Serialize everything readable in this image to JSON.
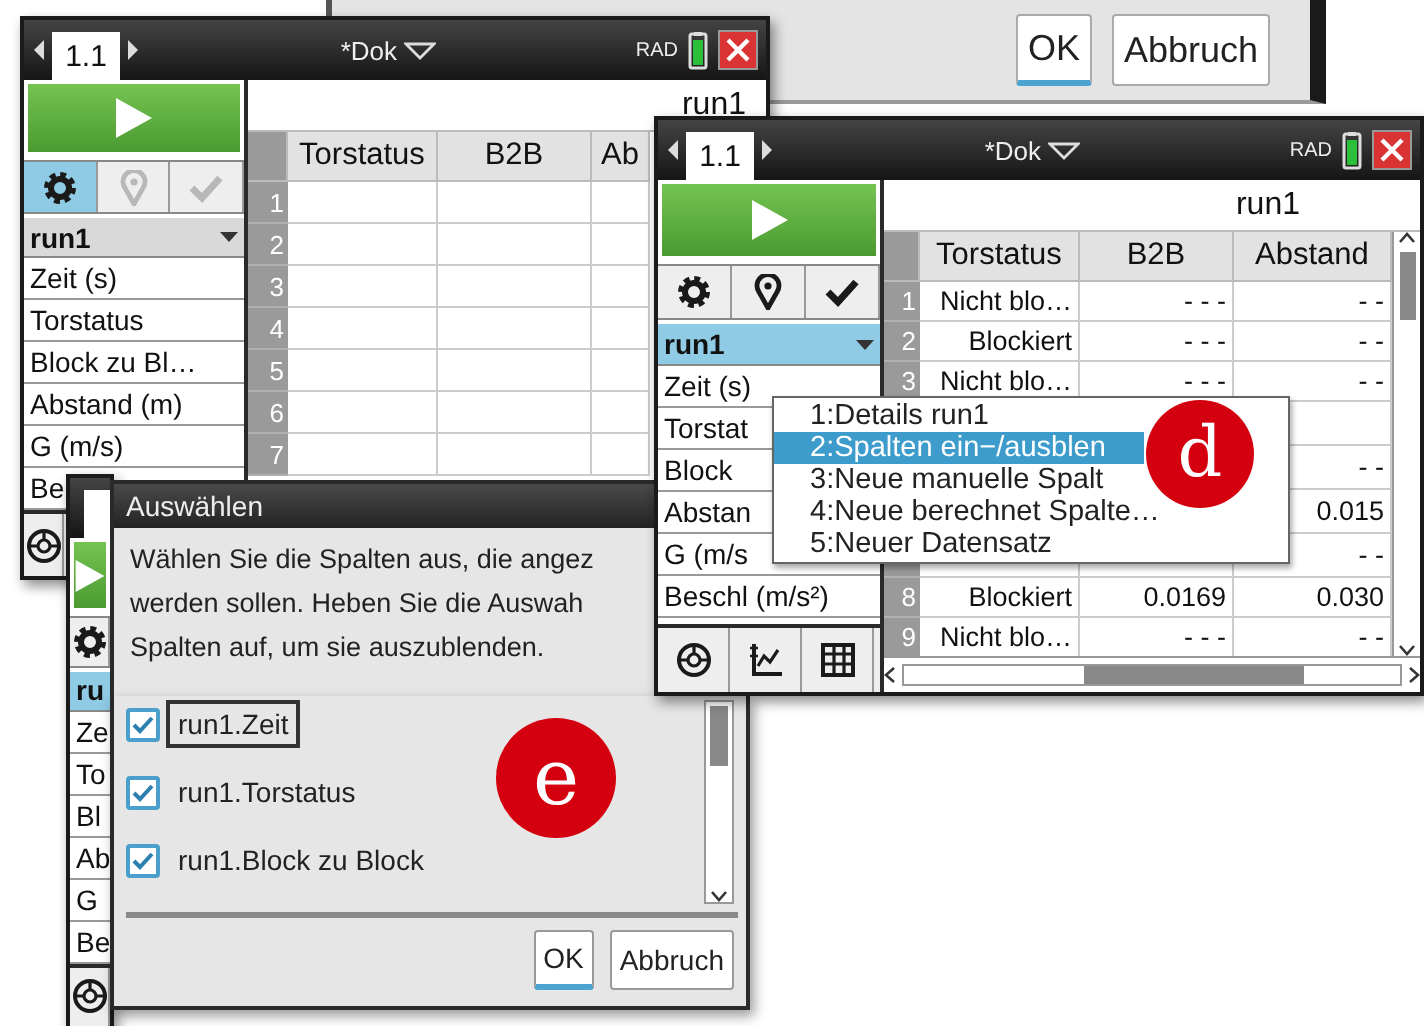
{
  "top_dialog": {
    "buttons": [
      {
        "label": "OK",
        "focused": true
      },
      {
        "label": "Abbruch",
        "focused": false
      }
    ]
  },
  "screens": [
    {
      "header": {
        "tab": "1.1",
        "document": "*Dok",
        "mode": "RAD"
      },
      "tools": [
        {
          "kind": "gear",
          "selected": true,
          "disabled": false
        },
        {
          "kind": "pin",
          "selected": false,
          "disabled": true
        },
        {
          "kind": "check",
          "selected": false,
          "disabled": true
        }
      ],
      "dataset": {
        "name": "run1",
        "selected": false
      },
      "columns_list": [
        "Zeit (s)",
        "Torstatus",
        "Block zu Bl…",
        "Abstand (m)",
        "G (m/s)",
        "Be"
      ],
      "bottom_tools": [
        {
          "kind": "gauge"
        }
      ],
      "table": {
        "title": "run1",
        "columns": [
          "Torstatus",
          "B2B",
          "Ab"
        ],
        "rows": [
          {
            "number": "1"
          },
          {
            "number": "2"
          },
          {
            "number": "3"
          },
          {
            "number": "4"
          },
          {
            "number": "5"
          },
          {
            "number": "6"
          },
          {
            "number": "7"
          }
        ]
      }
    },
    {
      "header": {
        "tab": "1.1",
        "document": "*Dok",
        "mode": "RAD"
      },
      "tools": [
        {
          "kind": "gear",
          "selected": false,
          "disabled": false
        },
        {
          "kind": "pin",
          "selected": false,
          "disabled": false
        },
        {
          "kind": "check",
          "selected": false,
          "disabled": false
        }
      ],
      "dataset": {
        "name": "run1",
        "selected": true
      },
      "columns_list": [
        "Zeit (s)",
        "Torstat",
        "Block",
        "Abstan",
        "G (m/s",
        "Beschl (m/s²)"
      ],
      "bottom_tools": [
        {
          "kind": "gauge"
        },
        {
          "kind": "graph"
        },
        {
          "kind": "table"
        }
      ],
      "table": {
        "title": "run1",
        "columns": [
          "Torstatus",
          "B2B",
          "Abstand"
        ],
        "rows": [
          {
            "number": "1",
            "torstatus": "Nicht blo…",
            "b2b": "- - -",
            "abstand": "- -"
          },
          {
            "number": "2",
            "torstatus": "Blockiert",
            "b2b": "- - -",
            "abstand": "- -"
          },
          {
            "number": "3",
            "torstatus": "Nicht blo…",
            "b2b": "- - -",
            "abstand": "- -"
          },
          {},
          {
            "abstand": "- -"
          },
          {
            "abstand": "0.015"
          },
          {
            "abstand": "- -"
          },
          {
            "number": "8",
            "torstatus": "Blockiert",
            "b2b": "0.0169",
            "abstand": "0.030"
          },
          {
            "number": "9",
            "torstatus": "Nicht blo…",
            "b2b": "- - -",
            "abstand": "- -"
          }
        ]
      },
      "menu": {
        "items": [
          {
            "label": "1:Details run1",
            "selected": false
          },
          {
            "label": "2:Spalten ein−/ausblen",
            "selected": true
          },
          {
            "label": "3:Neue manuelle Spalt",
            "selected": false
          },
          {
            "label": "4:Neue berechnet Spalte…",
            "selected": false
          },
          {
            "label": "5:Neuer Datensatz",
            "selected": false
          }
        ]
      }
    },
    {
      "tools": [
        {
          "kind": "gear",
          "selected": false,
          "disabled": false
        }
      ],
      "dataset": {
        "name": "ru",
        "selected": true
      },
      "columns_list": [
        "Ze",
        "To",
        "Bl",
        "Ab",
        "G",
        "Be"
      ],
      "bottom_tools": [
        {
          "kind": "gauge"
        }
      ]
    }
  ],
  "dialog": {
    "title": "Auswählen",
    "description_lines": [
      "Wählen Sie die Spalten aus, die angez",
      "werden sollen.  Heben Sie die Auswah",
      "Spalten auf, um sie auszublenden."
    ],
    "options": [
      {
        "label": "run1.Zeit",
        "checked": true,
        "focused": true
      },
      {
        "label": "run1.Torstatus",
        "checked": true,
        "focused": false
      },
      {
        "label": "run1.Block zu Block",
        "checked": true,
        "focused": false
      }
    ],
    "buttons": [
      {
        "label": "OK",
        "focused": true
      },
      {
        "label": "Abbruch",
        "focused": false
      }
    ]
  },
  "markers": [
    "d",
    "e"
  ]
}
